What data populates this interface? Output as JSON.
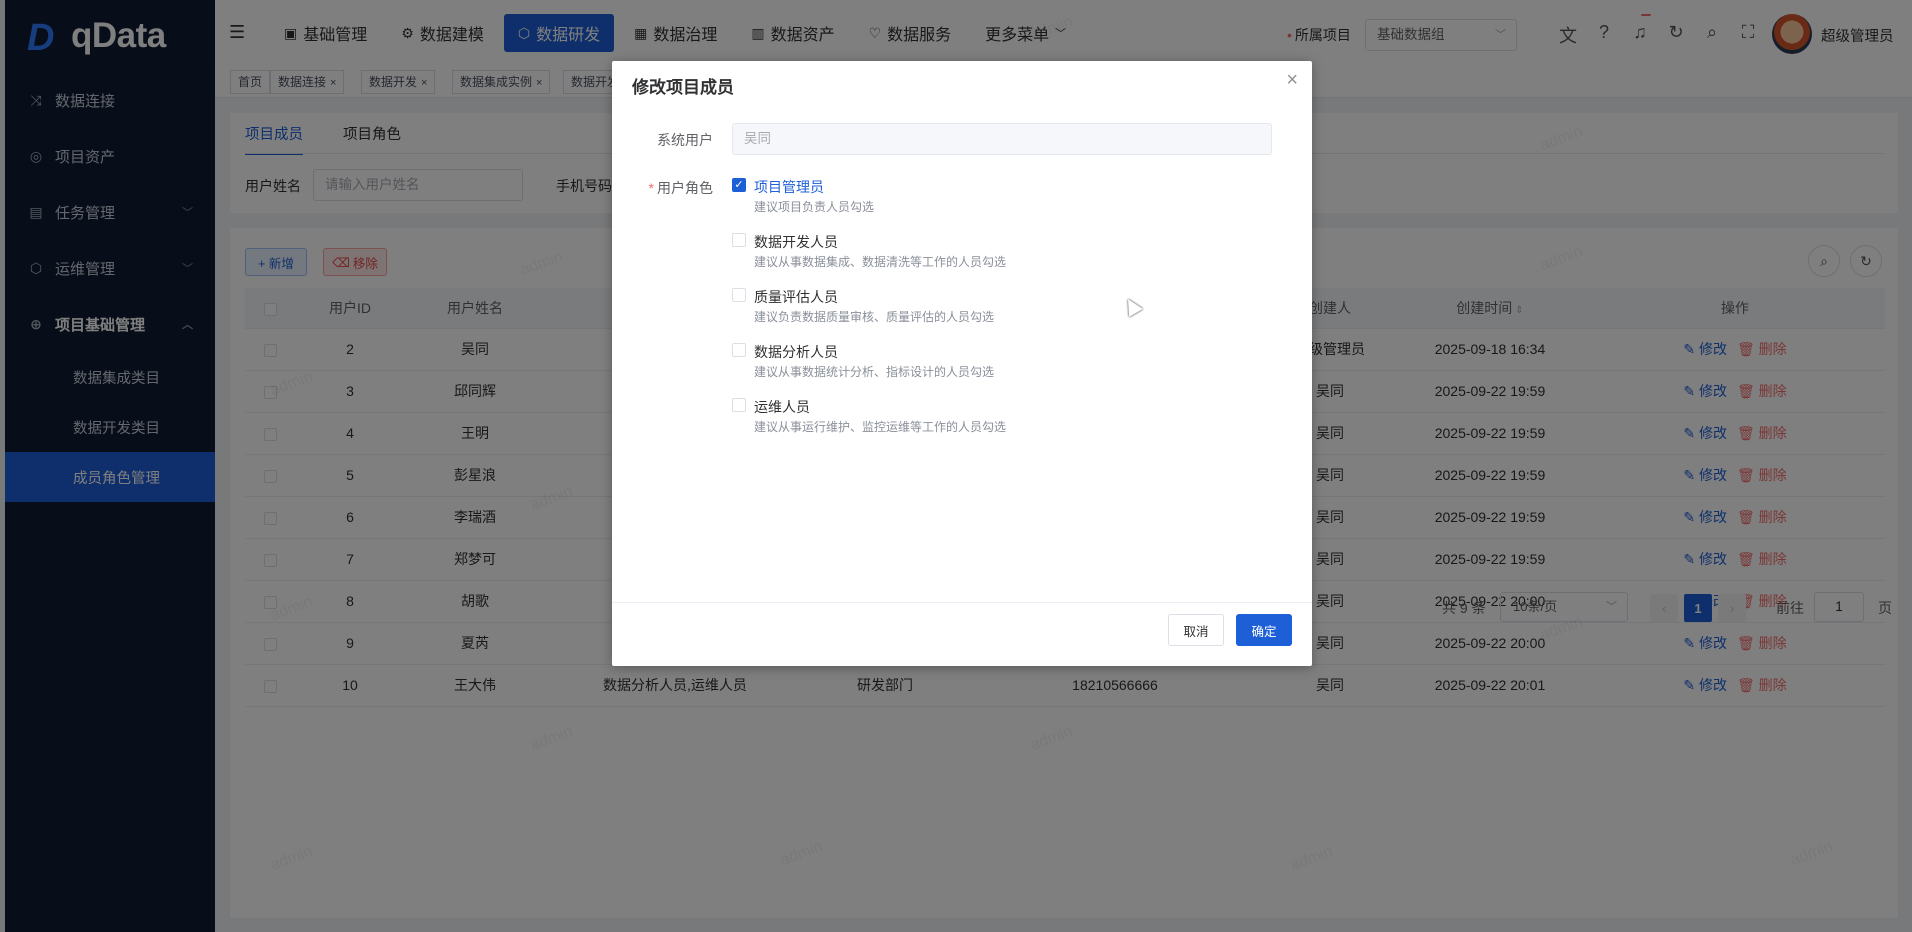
{
  "app": {
    "logo_text": "qData",
    "logo_mark": "D"
  },
  "sidebar": {
    "items": [
      {
        "label": "数据连接",
        "icon": "link-icon"
      },
      {
        "label": "项目资产",
        "icon": "asset-icon"
      },
      {
        "label": "任务管理",
        "icon": "task-icon",
        "expandable": true
      },
      {
        "label": "运维管理",
        "icon": "ops-icon",
        "expandable": true
      },
      {
        "label": "项目基础管理",
        "icon": "globe-icon",
        "expanded": true
      }
    ],
    "sub_items": [
      {
        "label": "数据集成类目",
        "active": false
      },
      {
        "label": "数据开发类目",
        "active": false
      },
      {
        "label": "成员角色管理",
        "active": true
      }
    ]
  },
  "header": {
    "nav": [
      {
        "label": "基础管理",
        "icon": "base-icon",
        "active": false
      },
      {
        "label": "数据建模",
        "icon": "model-icon",
        "active": false
      },
      {
        "label": "数据研发",
        "icon": "dev-icon",
        "active": true
      },
      {
        "label": "数据治理",
        "icon": "govern-icon",
        "active": false
      },
      {
        "label": "数据资产",
        "icon": "asset-icon",
        "active": false
      },
      {
        "label": "数据服务",
        "icon": "service-icon",
        "active": false
      },
      {
        "label": "更多菜单",
        "icon": "",
        "active": false
      }
    ],
    "project_label": "所属项目",
    "project_value": "基础数据组",
    "user_name": "超级管理员"
  },
  "tags": [
    "首页",
    "数据连接",
    "数据开发",
    "数据集成实例",
    "数据开发"
  ],
  "content": {
    "tabs": [
      {
        "label": "项目成员",
        "active": true
      },
      {
        "label": "项目角色",
        "active": false
      }
    ],
    "filter_name_label": "用户姓名",
    "filter_name_placeholder": "请输入用户姓名",
    "filter_phone_label": "手机号码",
    "add_label": "+ 新增",
    "remove_label": "移除",
    "columns": [
      "用户ID",
      "用户姓名",
      "创建人",
      "创建时间",
      "操作"
    ],
    "edit_label": "修改",
    "delete_label": "删除",
    "rows": [
      {
        "id": "2",
        "name": "吴同",
        "roles": "",
        "dept": "",
        "phone": "",
        "creator": "超级管理员",
        "created": "2025-09-18 16:34"
      },
      {
        "id": "3",
        "name": "邱同辉",
        "roles": "",
        "dept": "",
        "phone": "",
        "creator": "吴同",
        "created": "2025-09-22 19:59"
      },
      {
        "id": "4",
        "name": "王明",
        "roles": "",
        "dept": "",
        "phone": "",
        "creator": "吴同",
        "created": "2025-09-22 19:59"
      },
      {
        "id": "5",
        "name": "彭星浪",
        "roles": "",
        "dept": "",
        "phone": "",
        "creator": "吴同",
        "created": "2025-09-22 19:59"
      },
      {
        "id": "6",
        "name": "李瑞酒",
        "roles": "",
        "dept": "",
        "phone": "",
        "creator": "吴同",
        "created": "2025-09-22 19:59"
      },
      {
        "id": "7",
        "name": "郑梦可",
        "roles": "",
        "dept": "",
        "phone": "",
        "creator": "吴同",
        "created": "2025-09-22 19:59"
      },
      {
        "id": "8",
        "name": "胡歌",
        "roles": "",
        "dept": "",
        "phone": "",
        "creator": "吴同",
        "created": "2025-09-22 20:00"
      },
      {
        "id": "9",
        "name": "夏芮",
        "roles": "",
        "dept": "",
        "phone": "",
        "creator": "吴同",
        "created": "2025-09-22 20:00"
      },
      {
        "id": "10",
        "name": "王大伟",
        "roles": "数据分析人员,运维人员",
        "dept": "研发部门",
        "phone": "18210566666",
        "creator": "吴同",
        "created": "2025-09-22 20:01"
      }
    ],
    "pagination": {
      "total": "共 9 条",
      "page_size": "10条/页",
      "current": "1",
      "goto_label": "前往",
      "goto_value": "1",
      "page_unit": "页"
    }
  },
  "dialog": {
    "title": "修改项目成员",
    "system_user_label": "系统用户",
    "system_user_value": "吴同",
    "role_label": "用户角色",
    "roles": [
      {
        "name": "项目管理员",
        "desc": "建议项目负责人员勾选",
        "checked": true
      },
      {
        "name": "数据开发人员",
        "desc": "建议从事数据集成、数据清洗等工作的人员勾选",
        "checked": false
      },
      {
        "name": "质量评估人员",
        "desc": "建议负责数据质量审核、质量评估的人员勾选",
        "checked": false
      },
      {
        "name": "数据分析人员",
        "desc": "建议从事数据统计分析、指标设计的人员勾选",
        "checked": false
      },
      {
        "name": "运维人员",
        "desc": "建议从事运行维护、监控运维等工作的人员勾选",
        "checked": false
      }
    ],
    "cancel_label": "取消",
    "ok_label": "确定"
  },
  "watermark_text": "admin",
  "colors": {
    "primary": "#1d5fd6",
    "sidebar_bg": "#0f1c33",
    "danger": "#f56c6c"
  }
}
